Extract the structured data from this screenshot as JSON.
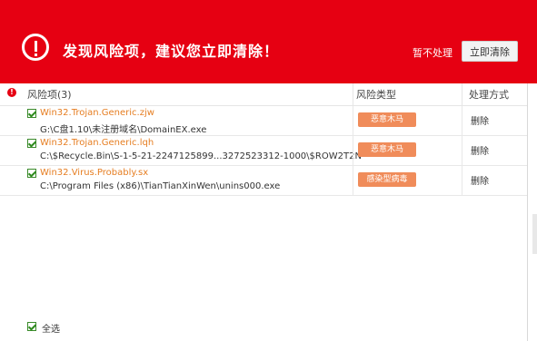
{
  "header": {
    "title": "发现风险项，建议您立即清除！",
    "ignore_label": "暂不处理",
    "clean_label": "立即清除",
    "accent": "#e60012"
  },
  "columns": {
    "risk_items": "风险项(3)",
    "risk_type": "风险类型",
    "action": "处理方式"
  },
  "rows": [
    {
      "name": "Win32.Trojan.Generic.zjw",
      "path": "G:\\C盘1.10\\未注册域名\\DomainEX.exe",
      "type": "恶意木马",
      "action": "删除"
    },
    {
      "name": "Win32.Trojan.Generic.lqh",
      "path": "C:\\$Recycle.Bin\\S-1-5-21-2247125899...3272523312-1000\\$ROW2T2N",
      "type": "恶意木马",
      "action": "删除"
    },
    {
      "name": "Win32.Virus.Probably.sx",
      "path": "C:\\Program Files (x86)\\TianTianXinWen\\unins000.exe",
      "type": "感染型病毒",
      "action": "删除"
    }
  ],
  "footer": {
    "select_all": "全选"
  },
  "icons": {
    "alert": "exclamation-circle-icon",
    "warn": "warning-dot-icon",
    "check": "checkmark-icon"
  }
}
